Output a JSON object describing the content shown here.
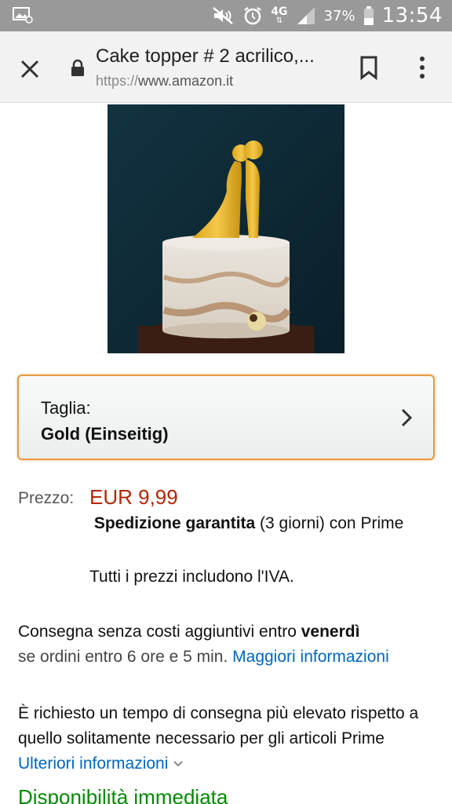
{
  "status_bar": {
    "network": "4G",
    "battery_percent": "37%",
    "time": "13:54"
  },
  "toolbar": {
    "title": "Cake topper # 2 acrilico,...",
    "url_scheme": "https://",
    "url_host": "www.amazon.it"
  },
  "size_selector": {
    "label": "Taglia:",
    "value": "Gold (Einseitig)"
  },
  "price": {
    "label": "Prezzo:",
    "value": "EUR 9,99",
    "shipping_bold": "Spedizione garantita",
    "shipping_rest": " (3 giorni) con Prime",
    "vat_note": "Tutti i prezzi includono l'IVA."
  },
  "delivery": {
    "text1": "Consegna senza costi aggiuntivi entro ",
    "day": "venerdì",
    "text2": "se ordini entro 6 ore e 5 min. ",
    "link": "Maggiori informazioni"
  },
  "note": {
    "text": "È richiesto un tempo di consegna più elevato rispetto a quello solitamente necessario per gli articoli Prime ",
    "link": "Ulteriori informazioni"
  },
  "availability": "Disponibilità immediata",
  "colors": {
    "price": "#b12704",
    "link": "#0066c0",
    "availability": "#008a00",
    "selector_border": "#e79b3d"
  }
}
